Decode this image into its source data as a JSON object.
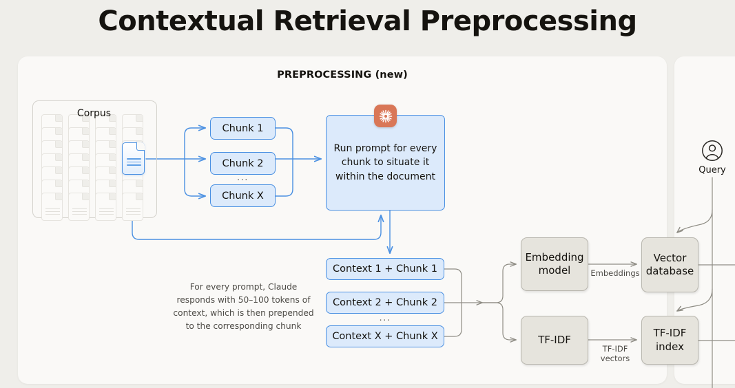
{
  "title": "Contextual Retrieval Preprocessing",
  "section": {
    "header": "PREPROCESSING (new)"
  },
  "corpus": {
    "label": "Corpus",
    "doc_columns": 4,
    "docs_per_column": 7
  },
  "chunks": {
    "items": [
      {
        "label": "Chunk 1"
      },
      {
        "label": "Chunk 2"
      },
      {
        "label": "Chunk X"
      }
    ],
    "ellipsis": "..."
  },
  "prompt": {
    "text": "Run prompt for every chunk to situate it within the document",
    "logo_icon": "claude-starburst-icon"
  },
  "contexts": {
    "items": [
      {
        "label": "Context 1 + Chunk 1"
      },
      {
        "label": "Context 2 + Chunk 2"
      },
      {
        "label": "Context X + Chunk X"
      }
    ],
    "ellipsis": "..."
  },
  "caption": "For every prompt, Claude responds with 50–100 tokens of context, which is then prepended to the corresponding chunk",
  "pipeline": {
    "embedding_model": "Embedding model",
    "tfidf": "TF-IDF",
    "vector_database": "Vector database",
    "tfidf_index": "TF-IDF index",
    "edge_embeddings": "Embeddings",
    "edge_tfidf_vectors": "TF-IDF vectors"
  },
  "query": {
    "label": "Query",
    "icon": "user-avatar-icon"
  },
  "colors": {
    "page_background": "#efeeea",
    "panel_background": "#faf9f7",
    "blue_accent": "#4a90e2",
    "blue_fill": "#dceafb",
    "gray_fill": "#e6e4dd",
    "gray_border": "#b8b6ae",
    "claude_orange": "#d97757",
    "text": "#15130f",
    "muted_text": "#4e4c47"
  }
}
